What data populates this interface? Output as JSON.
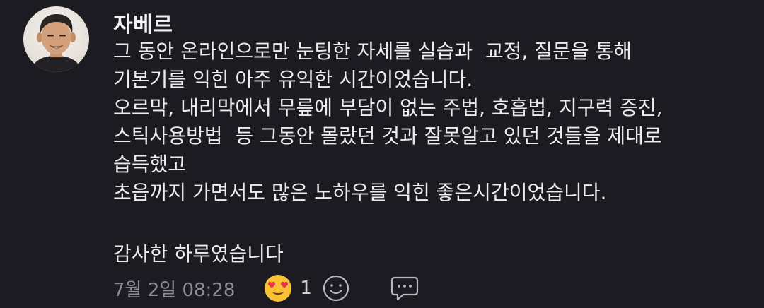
{
  "comment": {
    "author": "자베르",
    "lines": [
      "그 동안 온라인으로만 눈팅한 자세를 실습과  교정, 질문을 통해",
      "기본기를 익힌 아주 유익한 시간이었습니다.",
      "오르막, 내리막에서 무릎에 부담이 없는 주법, 호흡법, 지구력 증진,",
      "스틱사용방법  등 그동안 몰랐던 것과 잘못알고 있던 것들을 제대로",
      "습득했고",
      "초읍까지 가면서도 많은 노하우를 익힌 좋은시간이었습니다.",
      "감사한 하루였습니다"
    ],
    "timestamp": "7월 2일 08:28",
    "reaction": {
      "icon": "heart-eyes-emoji-icon",
      "count": "1"
    },
    "add_reaction_icon": "smiley-outline-icon",
    "reply_icon": "speech-bubble-icon"
  },
  "colors": {
    "background": "#1b1b21",
    "text": "#ececee",
    "meta_text": "#8d8d96",
    "emoji_face": "#f8c234",
    "emoji_heart": "#e8344d"
  }
}
